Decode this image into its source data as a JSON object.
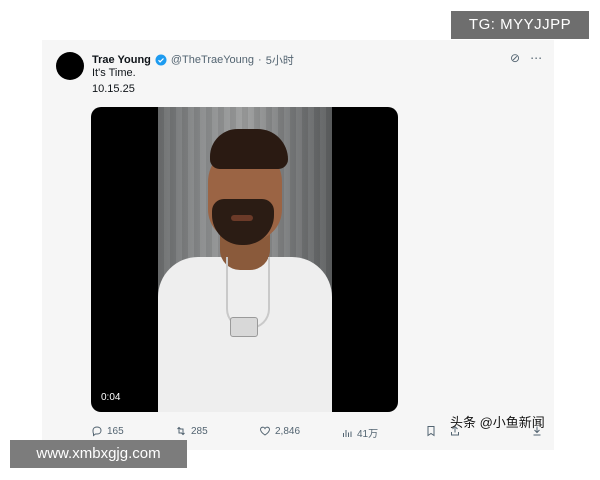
{
  "tweet": {
    "author_name": "Trae Young",
    "handle": "@TheTraeYoung",
    "separator": "·",
    "time": "5小时",
    "line1": "It's Time.",
    "line2": "10.15.25"
  },
  "video": {
    "time_label": "0:04"
  },
  "actions": {
    "reply_count": "165",
    "retweet_count": "285",
    "like_count": "2,846",
    "views_count": "41万"
  },
  "overlays": {
    "tg_label": "TG: MYYJJPP",
    "site_label": "www.xmbxgjg.com",
    "source_watermark": "头条 @小鱼新闻"
  },
  "colors": {
    "accent": "#1d9bf0",
    "muted": "#536471"
  }
}
